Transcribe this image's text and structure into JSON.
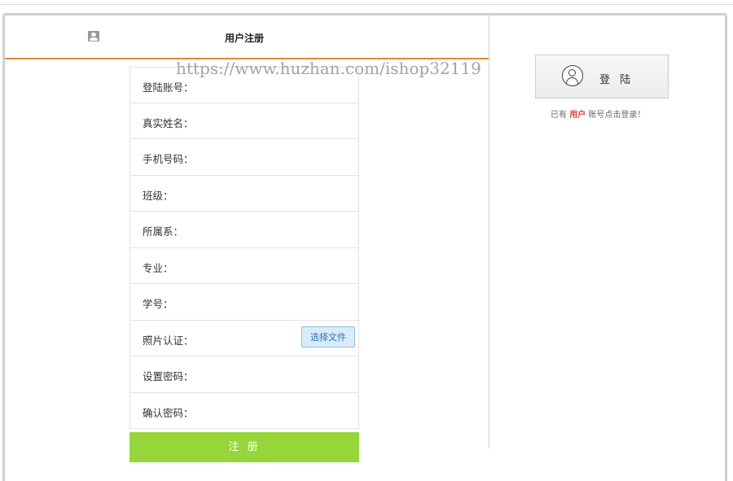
{
  "watermark": "https://www.huzhan.com/ishop32119",
  "tab": {
    "title": "用户注册",
    "icon": "user-icon"
  },
  "form": {
    "fields": [
      {
        "label": "登陆账号：",
        "name": "account-field"
      },
      {
        "label": "真实姓名：",
        "name": "real-name-field"
      },
      {
        "label": "手机号码：",
        "name": "phone-field"
      },
      {
        "label": "班级：",
        "name": "class-field"
      },
      {
        "label": "所属系：",
        "name": "department-field"
      },
      {
        "label": "专业：",
        "name": "major-field"
      },
      {
        "label": "学号：",
        "name": "student-id-field"
      },
      {
        "label": "照片认证：",
        "name": "photo-field"
      },
      {
        "label": "设置密码：",
        "name": "password-field"
      },
      {
        "label": "确认密码：",
        "name": "confirm-password-field"
      }
    ],
    "file_button": "选择文件",
    "submit": "注 册"
  },
  "login": {
    "button_label": "登 陆",
    "icon": "user-circle-icon",
    "hint_prefix": "已有",
    "hint_highlight": "用户",
    "hint_suffix": "账号点击登录！"
  },
  "colors": {
    "accent_orange": "#e8863a",
    "submit_green": "#96d63a",
    "highlight_red": "#e23b2e",
    "file_button_bg": "#d8ecf8"
  }
}
